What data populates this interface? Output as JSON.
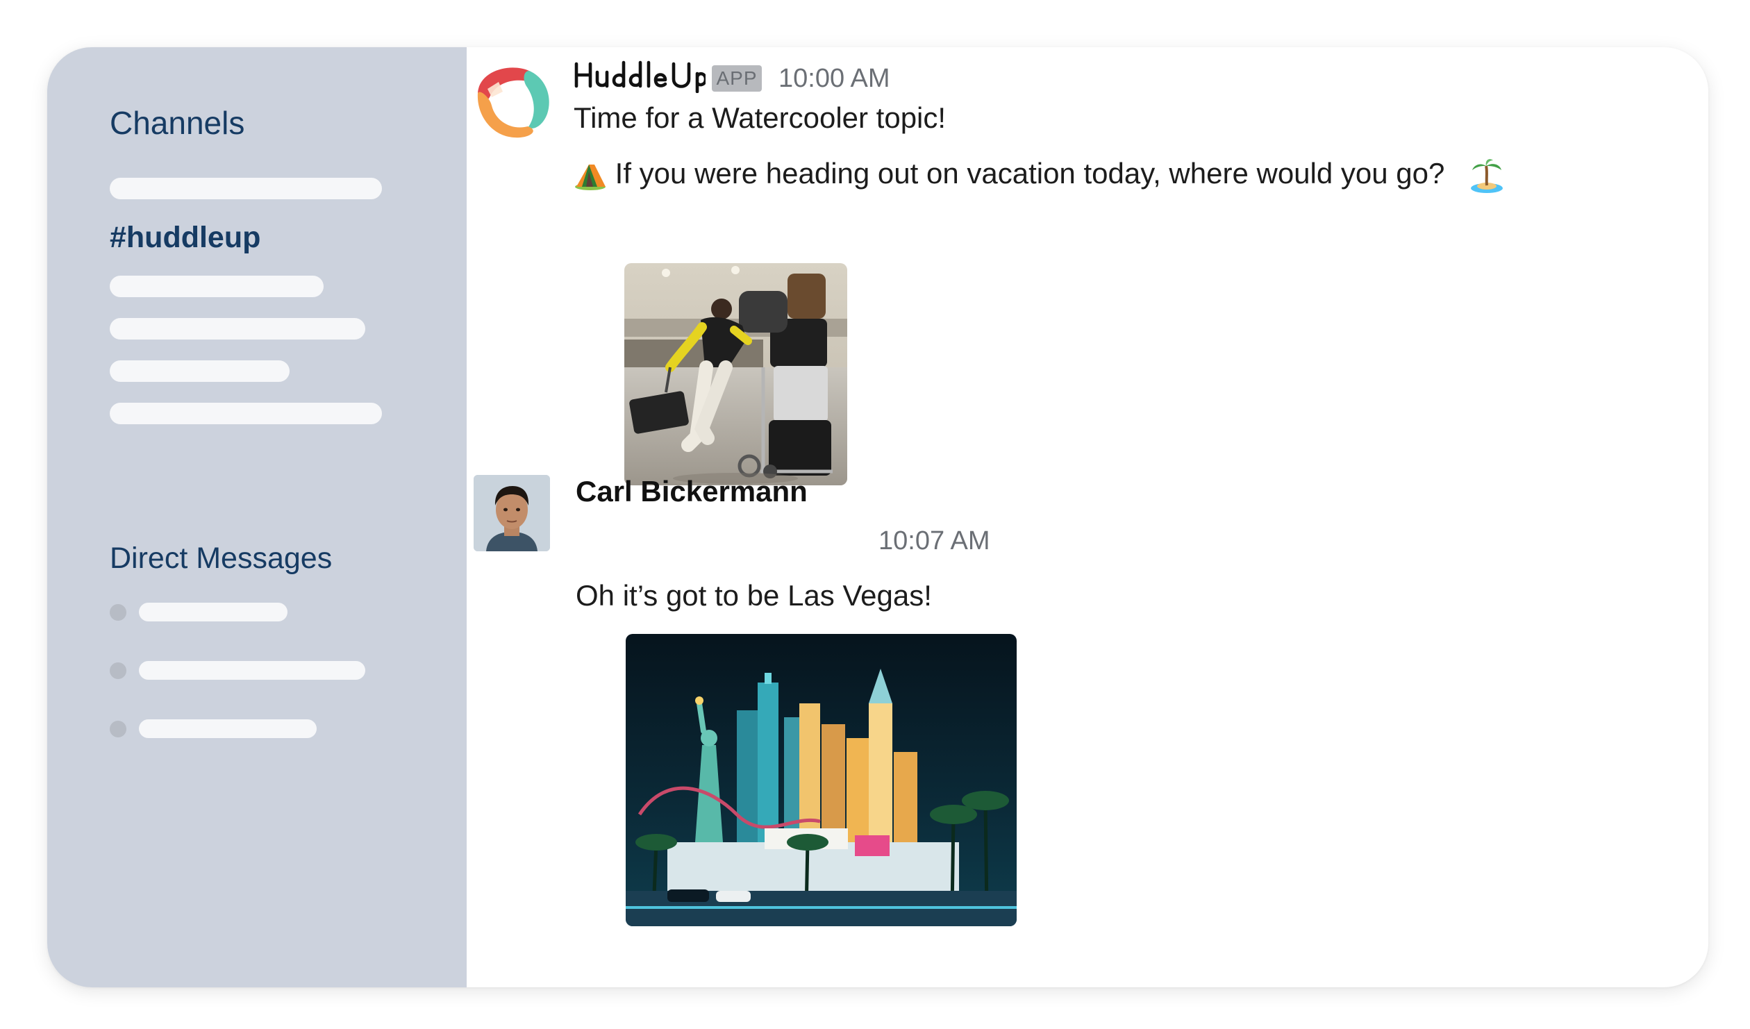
{
  "sidebar": {
    "channels_heading": "Channels",
    "active_channel": "#huddleup",
    "dm_heading": "Direct Messages"
  },
  "messages": [
    {
      "sender": "HuddleUp",
      "badge": "APP",
      "time": "10:00 AM",
      "text": "Time for a Watercooler topic!",
      "prompt": "If you were heading out on vacation today, where would you go?",
      "prompt_lead_icon": "camping-tent-icon",
      "prompt_trail_icon": "desert-island-icon",
      "image": "airport-luggage-gif"
    },
    {
      "sender": "Carl Bickermann",
      "time": "10:07 AM",
      "text": "Oh it’s got to be Las Vegas!",
      "image": "las-vegas-night-photo"
    }
  ],
  "colors": {
    "sidebar_bg": "#ccd2dd",
    "sidebar_text": "#163b63",
    "logo_red": "#e2474b",
    "logo_orange": "#f5a04a",
    "logo_teal": "#5cc9b3"
  }
}
